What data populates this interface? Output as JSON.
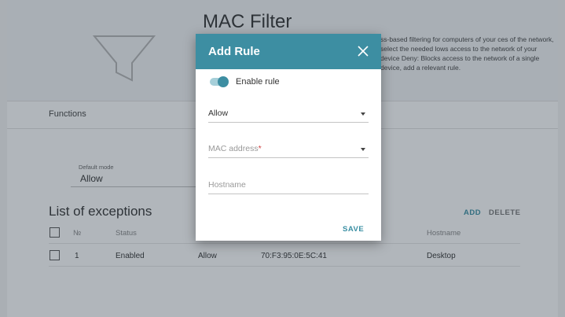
{
  "page": {
    "title": "MAC Filter",
    "description": "ss-based filtering for computers of your ces of the network, select the needed lows access to the network of your device Deny: Blocks access to the network of a single device, add a relevant rule.",
    "functions_label": "Functions",
    "default_mode": {
      "label": "Default mode",
      "value": "Allow"
    },
    "exceptions": {
      "title": "List of exceptions",
      "add_label": "ADD",
      "delete_label": "DELETE",
      "columns": {
        "number": "№",
        "status": "Status",
        "hostname": "Hostname"
      },
      "rows": [
        {
          "number": "1",
          "status": "Enabled",
          "mode": "Allow",
          "mac": "70:F3:95:0E:5C:41",
          "hostname": "Desktop"
        }
      ]
    }
  },
  "modal": {
    "title": "Add Rule",
    "enable_rule_label": "Enable rule",
    "enable_rule_on": true,
    "mode_value": "Allow",
    "mac_placeholder": "MAC address",
    "required_mark": "*",
    "hostname_placeholder": "Hostname",
    "save_label": "SAVE"
  },
  "icons": {
    "funnel": "funnel-icon",
    "close": "close-icon",
    "dropdown": "chevron-down-icon"
  },
  "colors": {
    "accent": "#3d8ea2",
    "overlay": "rgba(40, 52, 66, 0.36)",
    "required": "#d04040"
  }
}
